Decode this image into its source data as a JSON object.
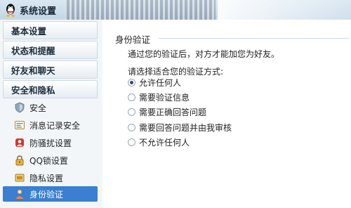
{
  "app": {
    "title": "系统设置"
  },
  "sidebar": {
    "categories": [
      {
        "label": "基本设置"
      },
      {
        "label": "状态和提醒"
      },
      {
        "label": "好友和聊天"
      },
      {
        "label": "安全和隐私"
      }
    ],
    "items": [
      {
        "label": "安全",
        "icon": "shield-icon"
      },
      {
        "label": "消息记录安全",
        "icon": "message-record-icon"
      },
      {
        "label": "防骚扰设置",
        "icon": "anti-harass-icon"
      },
      {
        "label": "QQ锁设置",
        "icon": "lock-icon"
      },
      {
        "label": "隐私设置",
        "icon": "privacy-icon"
      },
      {
        "label": "身份验证",
        "icon": "user-verify-icon",
        "selected": true
      }
    ]
  },
  "main": {
    "section_title": "身份验证",
    "description": "通过您的验证后，对方才能加您为好友。",
    "prompt": "请选择适合您的验证方式:",
    "options": [
      {
        "label": "允许任何人",
        "selected": true
      },
      {
        "label": "需要验证信息",
        "selected": false
      },
      {
        "label": "需要正确回答问题",
        "selected": false
      },
      {
        "label": "需要回答问题并由我审核",
        "selected": false
      },
      {
        "label": "不允许任何人",
        "selected": false
      }
    ]
  },
  "colors": {
    "selected_bg": "#3a7fd0",
    "accent": "#2c4a73"
  }
}
